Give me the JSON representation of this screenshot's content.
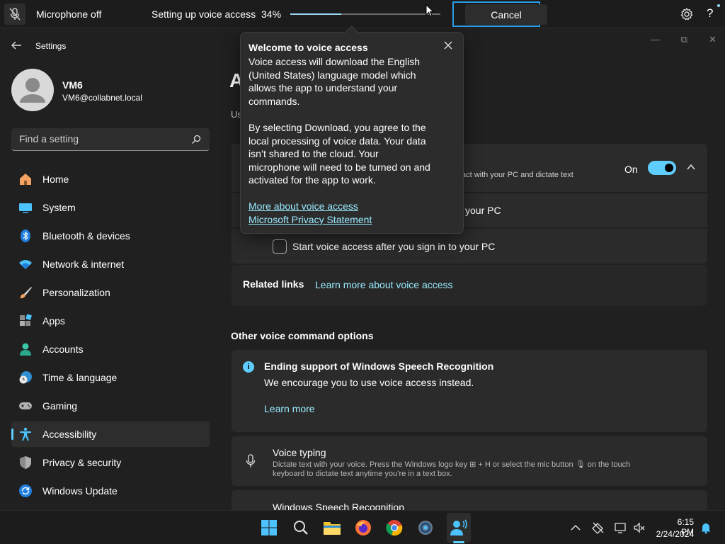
{
  "voice_access_bar": {
    "mic_label": "Microphone off",
    "status_text": "Setting up voice access",
    "progress_percent": "34%",
    "progress_value": 0.34,
    "cancel_label": "Cancel",
    "settings_icon": "gear-icon",
    "help_label": "?"
  },
  "window": {
    "app_title": "Settings",
    "controls": [
      "minimize",
      "restore",
      "close"
    ]
  },
  "user": {
    "name": "VM6",
    "email": "VM6@collabnet.local"
  },
  "search": {
    "placeholder": "Find a setting"
  },
  "sidebar": {
    "items": [
      {
        "label": "Home",
        "icon": "home-icon"
      },
      {
        "label": "System",
        "icon": "system-icon"
      },
      {
        "label": "Bluetooth & devices",
        "icon": "bluetooth-icon"
      },
      {
        "label": "Network & internet",
        "icon": "wifi-icon"
      },
      {
        "label": "Personalization",
        "icon": "brush-icon"
      },
      {
        "label": "Apps",
        "icon": "apps-icon"
      },
      {
        "label": "Accounts",
        "icon": "accounts-icon"
      },
      {
        "label": "Time & language",
        "icon": "clock-globe-icon"
      },
      {
        "label": "Gaming",
        "icon": "gamepad-icon"
      },
      {
        "label": "Accessibility",
        "icon": "accessibility-icon"
      },
      {
        "label": "Privacy & security",
        "icon": "shield-icon"
      },
      {
        "label": "Windows Update",
        "icon": "update-icon"
      }
    ],
    "active_index": 9
  },
  "main": {
    "title_partial": "A",
    "subtitle_partial": "Us",
    "voice_access_row": {
      "desc_partial": "act with your PC and dictate text",
      "toggle_label": "On",
      "toggle_on": true
    },
    "row2_partial": "your PC",
    "row3_checkbox_label": "Start voice access after you sign in to your PC",
    "related": {
      "title": "Related links",
      "link": "Learn more about voice access"
    },
    "other_section_title": "Other voice command options",
    "speech_notice": {
      "title": "Ending support of Windows Speech Recognition",
      "body": "We encourage you to use voice access instead.",
      "link": "Learn more"
    },
    "voice_typing": {
      "title": "Voice typing",
      "desc_line1": "Dictate text with your voice. Press the Windows logo key ⊞ + H or select the mic button 🎙 on the touch",
      "desc_line2": "keyboard to dictate text anytime you’re in a text box."
    },
    "wsr_title": "Windows Speech Recognition"
  },
  "flyout": {
    "title": "Welcome to voice access",
    "paragraph1": "Voice access will download the English (United States) language model which allows the app to understand your commands.",
    "paragraph2": "By selecting Download, you agree to the local processing of voice data. Your data isn’t shared to the cloud. Your microphone will need to be turned on and activated for the app to work.",
    "link1": "More about voice access",
    "link2": "Microsoft Privacy Statement"
  },
  "taskbar": {
    "apps": [
      "windows-start-icon",
      "search-icon",
      "file-explorer-icon",
      "firefox-icon",
      "chrome-icon",
      "settings-icon",
      "voice-access-icon"
    ],
    "time": "6:15 PM",
    "date": "2/24/2024"
  },
  "colors": {
    "accent": "#60cdff",
    "link": "#99ebff",
    "focus_ring": "#2b9ce8",
    "background": "#202020",
    "card": "#2b2b2b"
  }
}
